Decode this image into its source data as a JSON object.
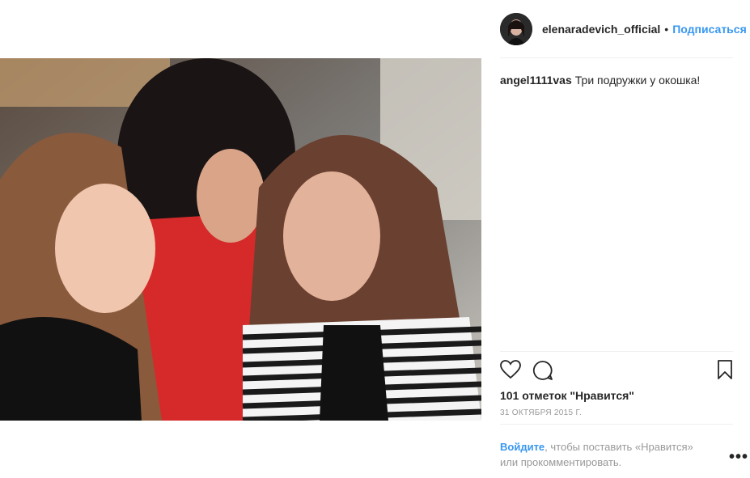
{
  "post": {
    "author": "elenaradevich_official",
    "separator": "•",
    "follow_label": "Подписаться",
    "caption_user": "angel1111vas",
    "caption_text": "Три подружки у окошка!",
    "likes_text": "101 отметок \"Нравится\"",
    "date_text": "31 ОКТЯБРЯ 2015 Г.",
    "login_link": "Войдите",
    "login_rest": ", чтобы поставить «Нравится» или прокомментировать.",
    "more_label": "•••"
  },
  "icons": {
    "like": "heart-icon",
    "comment": "comment-icon",
    "save": "bookmark-icon",
    "more": "more-options-icon"
  },
  "colors": {
    "accent": "#3897f0",
    "text": "#262626",
    "muted": "#999999",
    "divider": "#efefef"
  }
}
